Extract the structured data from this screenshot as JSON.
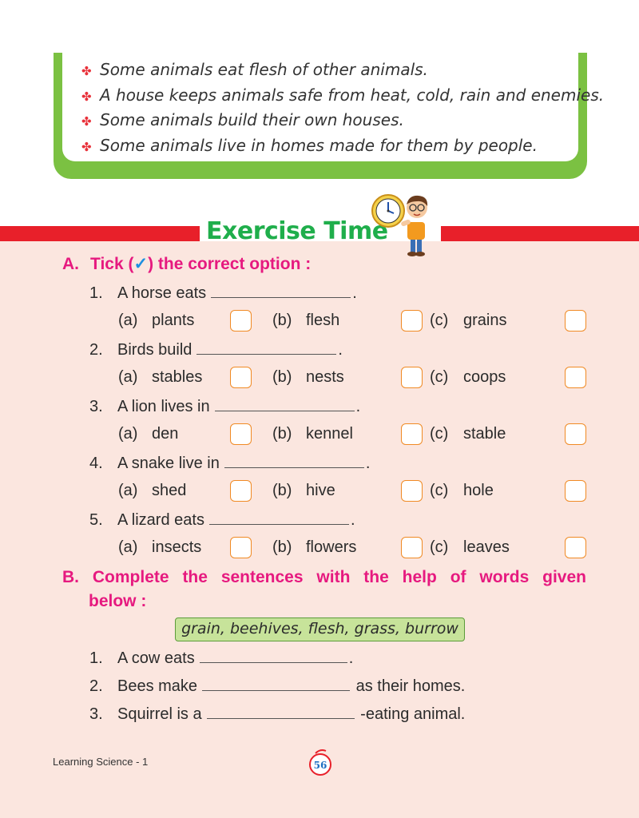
{
  "summary": {
    "items": [
      "Some animals eat flesh of other animals.",
      "A house keeps animals safe from heat, cold, rain and enemies.",
      "Some animals build their own houses.",
      "Some animals live in homes made for them by people."
    ]
  },
  "exercise_title": "Exercise Time",
  "section_a": {
    "label": "A.",
    "heading_pre": "Tick (",
    "tick": "✓",
    "heading_post": ") the correct option :",
    "questions": [
      {
        "num": "1.",
        "text": "A horse eats",
        "end": ".",
        "options": [
          {
            "label": "(a)",
            "text": "plants"
          },
          {
            "label": "(b)",
            "text": "flesh"
          },
          {
            "label": "(c)",
            "text": "grains"
          }
        ]
      },
      {
        "num": "2.",
        "text": "Birds build",
        "end": ".",
        "options": [
          {
            "label": "(a)",
            "text": "stables"
          },
          {
            "label": "(b)",
            "text": "nests"
          },
          {
            "label": "(c)",
            "text": "coops"
          }
        ]
      },
      {
        "num": "3.",
        "text": "A lion lives in",
        "end": ".",
        "options": [
          {
            "label": "(a)",
            "text": "den"
          },
          {
            "label": "(b)",
            "text": "kennel"
          },
          {
            "label": "(c)",
            "text": "stable"
          }
        ]
      },
      {
        "num": "4.",
        "text": "A snake live in",
        "end": ".",
        "options": [
          {
            "label": "(a)",
            "text": "shed"
          },
          {
            "label": "(b)",
            "text": "hive"
          },
          {
            "label": "(c)",
            "text": "hole"
          }
        ]
      },
      {
        "num": "5.",
        "text": "A lizard eats",
        "end": ".",
        "options": [
          {
            "label": "(a)",
            "text": "insects"
          },
          {
            "label": "(b)",
            "text": "flowers"
          },
          {
            "label": "(c)",
            "text": "leaves"
          }
        ]
      }
    ]
  },
  "section_b": {
    "label": "B.",
    "heading_words": [
      "Complete",
      "the",
      "sentences",
      "with",
      "the",
      "help",
      "of",
      "words",
      "given"
    ],
    "heading_line2": "below :",
    "word_bank": "grain, beehives, flesh, grass, burrow",
    "sentences": [
      {
        "num": "1.",
        "before": "A cow eats",
        "after": "."
      },
      {
        "num": "2.",
        "before": "Bees make",
        "after": "as their homes."
      },
      {
        "num": "3.",
        "before": "Squirrel is a",
        "after": "-eating animal."
      }
    ]
  },
  "footer": {
    "book": "Learning Science - 1",
    "page": "56"
  },
  "colors": {
    "green": "#7bc142",
    "title_green": "#1fae4b",
    "red_band": "#e8202a",
    "magenta": "#e6197f",
    "pink_bg": "#fbe6df",
    "checkbox_orange": "#f08a24"
  }
}
